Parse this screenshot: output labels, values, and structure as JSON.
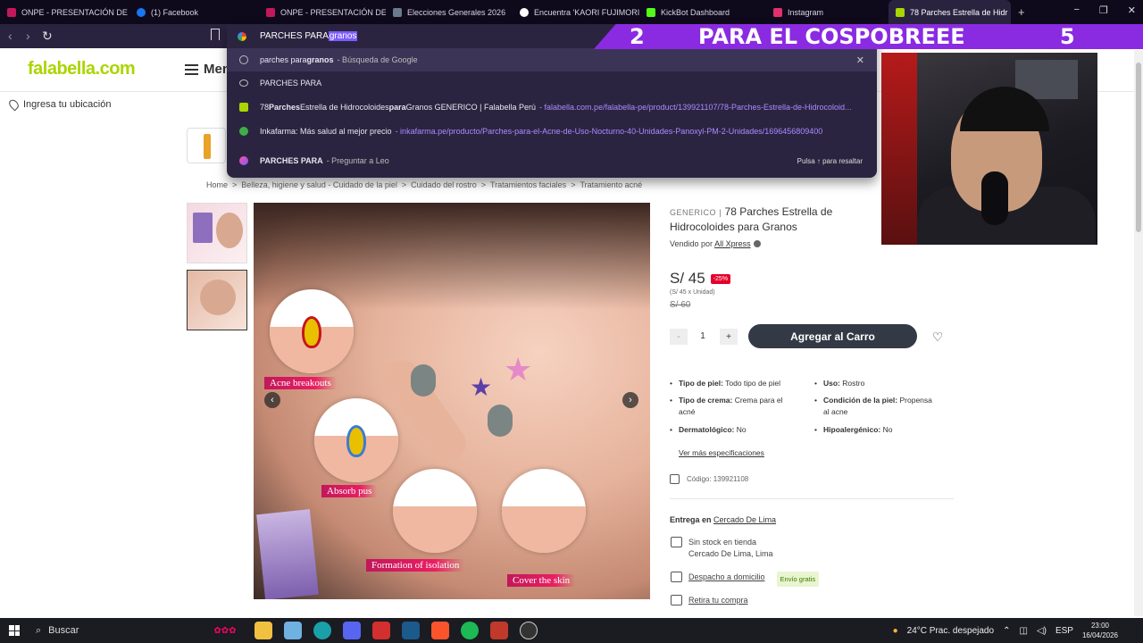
{
  "tabs": [
    {
      "title": "ONPE - PRESENTACIÓN DE RES",
      "color": "#c2185b"
    },
    {
      "title": "(1) Facebook",
      "color": "#1877f2"
    },
    {
      "title": "ONPE - PRESENTACIÓN DE RES",
      "color": "#c2185b"
    },
    {
      "title": "Elecciones Generales 2026",
      "color": "#6b7b8c"
    },
    {
      "title": "Encuentra 'KAORI FUJIMORI' e",
      "color": "#111111"
    },
    {
      "title": "KickBot Dashboard",
      "color": "#53fc18"
    },
    {
      "title": "Instagram",
      "color": "#e1306c"
    },
    {
      "title": "78 Parches Estrella de Hidr",
      "color": "#aad500"
    }
  ],
  "omnibox": {
    "typed": "PARCHES PARA",
    "autocomplete": "granos",
    "suggestions": [
      {
        "pre": "parches para ",
        "bold": "granos",
        "suffix": "- Búsqueda de Google"
      },
      {
        "text": "PARCHES PARA"
      },
      {
        "pre": "78 ",
        "bold": "Parches",
        "mid": " Estrella de Hidrocoloides ",
        "bold2": "para",
        "post": " Granos GENERICO | Falabella Perú",
        "url": "- falabella.com.pe/falabella-pe/product/139921107/78-Parches-Estrella-de-Hidrocoloid..."
      },
      {
        "text": "Inkafarma: Más salud al mejor precio",
        "url": "- inkafarma.pe/producto/Parches-para-el-Acne-de-Uso-Nocturno-40-Unidades-Panoxyl-PM-2-Unidades/1696456809400"
      },
      {
        "bold": "PARCHES PARA",
        "suffix": "- Preguntar a Leo"
      }
    ],
    "hint": "Pulsa ↑ para resaltar"
  },
  "overlay": {
    "left_num": "2",
    "banner_text": "PARA EL COSPOBREEE",
    "right_num": "5"
  },
  "header": {
    "logo": "falabella.com",
    "menu_label": "Menú",
    "location": "Ingresa tu ubicación"
  },
  "breadcrumb": [
    "Home",
    ">",
    "Belleza, higiene y salud - Cuidado de la piel",
    ">",
    "Cuidado del rostro",
    ">",
    "Tratamientos faciales",
    ">",
    "Tratamiento acné"
  ],
  "image_labels": [
    "Acne breakouts",
    "Absorb pus",
    "Formation of isolation",
    "Cover the skin"
  ],
  "product": {
    "brand": "GENERICO",
    "sep": "|",
    "title": "78 Parches Estrella de Hidrocoloides para Granos",
    "seller_prefix": "Vendido por",
    "seller": "All Xpress",
    "price": "S/ 45",
    "discount": "-25%",
    "unit_price": "(S/ 45 x Unidad)",
    "old_price": "S/ 60",
    "qty": "1",
    "qty_minus": "-",
    "qty_plus": "+",
    "add_to_cart": "Agregar al Carro",
    "specs": [
      {
        "k": "Tipo de piel:",
        "v": "Todo tipo de piel"
      },
      {
        "k": "Uso:",
        "v": "Rostro"
      },
      {
        "k": "Tipo de crema:",
        "v": "Crema para el acné"
      },
      {
        "k": "Condición de la piel:",
        "v": "Propensa al acne"
      },
      {
        "k": "Dermatológico:",
        "v": "No"
      },
      {
        "k": "Hipoalergénico:",
        "v": "No"
      }
    ],
    "more_specs": "Ver más especificaciones",
    "code": "Código: 139921108"
  },
  "delivery": {
    "title_prefix": "Entrega en",
    "location": "Cercado De Lima",
    "stock_line1": "Sin stock en tienda",
    "stock_line2": "Cercado De Lima, Lima",
    "home_delivery": "Despacho a domicilio",
    "free": "Envío gratis",
    "pickup": "Retira tu compra"
  },
  "taskbar": {
    "search": "Buscar",
    "weather": "24°C  Prac. despejado",
    "lang": "ESP",
    "time": "23:00",
    "date": "16/04/2026"
  }
}
